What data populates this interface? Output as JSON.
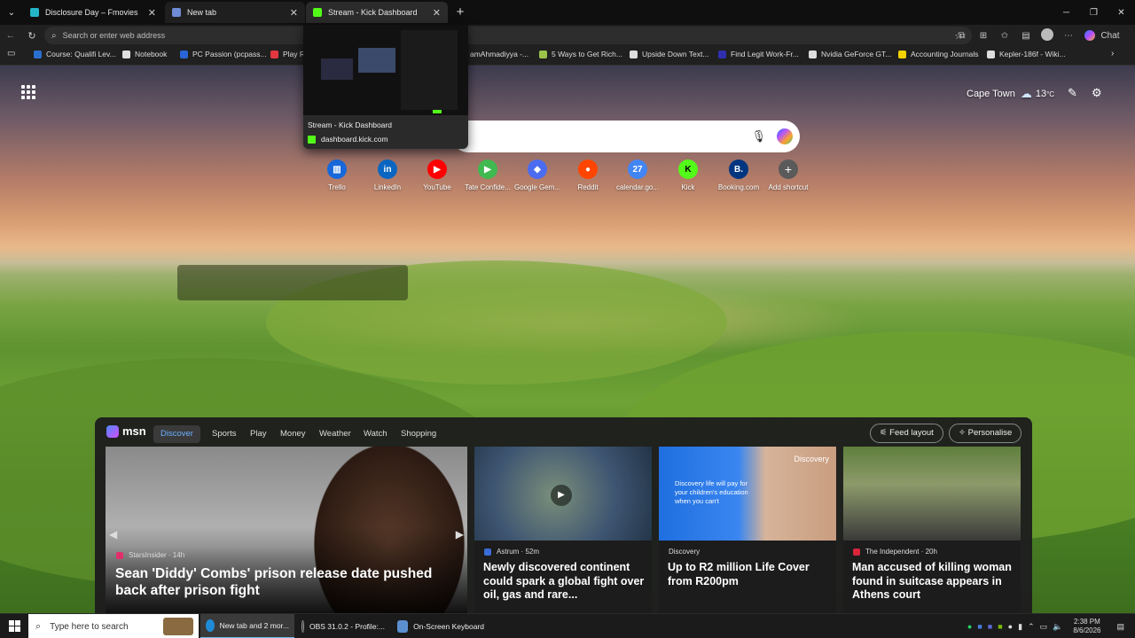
{
  "browser": {
    "tabs": [
      {
        "title": "Disclosure Day – Fmovies",
        "fav": "#24b6c6"
      },
      {
        "title": "New tab",
        "fav": "#6f8bd6"
      },
      {
        "title": "Stream - Kick Dashboard",
        "fav": "#53fc18"
      }
    ],
    "address_placeholder": "Search or enter web address",
    "chat_label": "Chat",
    "bookmarks": [
      {
        "label": "Course: Qualifi Lev...",
        "color": "#2b6fce"
      },
      {
        "label": "Notebook",
        "color": "#e0e0e0"
      },
      {
        "label": "PC Passion (pcpass...",
        "color": "#2a64d6"
      },
      {
        "label": "Play R...",
        "color": "#e2373f"
      },
      {
        "label": "amAhmadiyya -...",
        "color": "#aaaaaa"
      },
      {
        "label": "5 Ways to Get Rich...",
        "color": "#9bc34a"
      },
      {
        "label": "Upside Down Text...",
        "color": "#dddddd"
      },
      {
        "label": "Find Legit Work-Fr...",
        "color": "#2f2fb0"
      },
      {
        "label": "Nvidia GeForce GT...",
        "color": "#dddddd"
      },
      {
        "label": "Accounting Journals",
        "color": "#f2d100"
      },
      {
        "label": "Kepler-186f - Wiki...",
        "color": "#dddddd"
      }
    ]
  },
  "tab_preview": {
    "title": "Stream - Kick Dashboard",
    "url": "dashboard.kick.com"
  },
  "newtab": {
    "weather_city": "Cape Town",
    "weather_temp": "13",
    "weather_unit": "°C",
    "shortcuts": [
      {
        "label": "Trello",
        "glyph": "▥",
        "color": "#1868db"
      },
      {
        "label": "LinkedIn",
        "glyph": "in",
        "color": "#0a66c2"
      },
      {
        "label": "YouTube",
        "glyph": "▶",
        "color": "#ff0000"
      },
      {
        "label": "Tate Confide...",
        "glyph": "▶",
        "color": "#3fb950"
      },
      {
        "label": "Google Gem...",
        "glyph": "◆",
        "color": "#4b6cf0"
      },
      {
        "label": "Reddit",
        "glyph": "●",
        "color": "#ff4500"
      },
      {
        "label": "calendar.go...",
        "glyph": "27",
        "color": "#4285f4"
      },
      {
        "label": "Kick",
        "glyph": "K",
        "color": "#53fc18"
      },
      {
        "label": "Booking.com",
        "glyph": "B.",
        "color": "#003580"
      },
      {
        "label": "Add shortcut",
        "glyph": "+",
        "color": "#5a5a5a"
      }
    ]
  },
  "feed": {
    "brand": "msn",
    "tabs": [
      "Discover",
      "Sports",
      "Play",
      "Money",
      "Weather",
      "Watch",
      "Shopping"
    ],
    "feed_layout": "Feed layout",
    "personalise": "Personalise",
    "cards": [
      {
        "source": "StarsInsider · 14h",
        "headline": "Sean 'Diddy' Combs' prison release date pushed back after prison fight"
      },
      {
        "source": "Astrum · 52m",
        "headline": "Newly discovered continent could spark a global fight over oil, gas and rare..."
      },
      {
        "source": "Discovery",
        "headline": "Up to R2 million Life Cover from R200pm",
        "ad_text": "Discovery life will pay for your children's education when you can't",
        "ad_brand": "Discovery"
      },
      {
        "source": "The Independent · 20h",
        "headline": "Man accused of killing woman found in suitcase appears in Athens court"
      }
    ]
  },
  "taskbar": {
    "search_placeholder": "Type here to search",
    "apps": [
      {
        "label": "New tab and 2 mor...",
        "color": "#1f8ad6"
      },
      {
        "label": "OBS 31.0.2 - Profile:...",
        "color": "#333333"
      },
      {
        "label": "On-Screen Keyboard",
        "color": "#5b8fd0"
      }
    ],
    "time": "2:38 PM",
    "date": "8/6/2026"
  }
}
